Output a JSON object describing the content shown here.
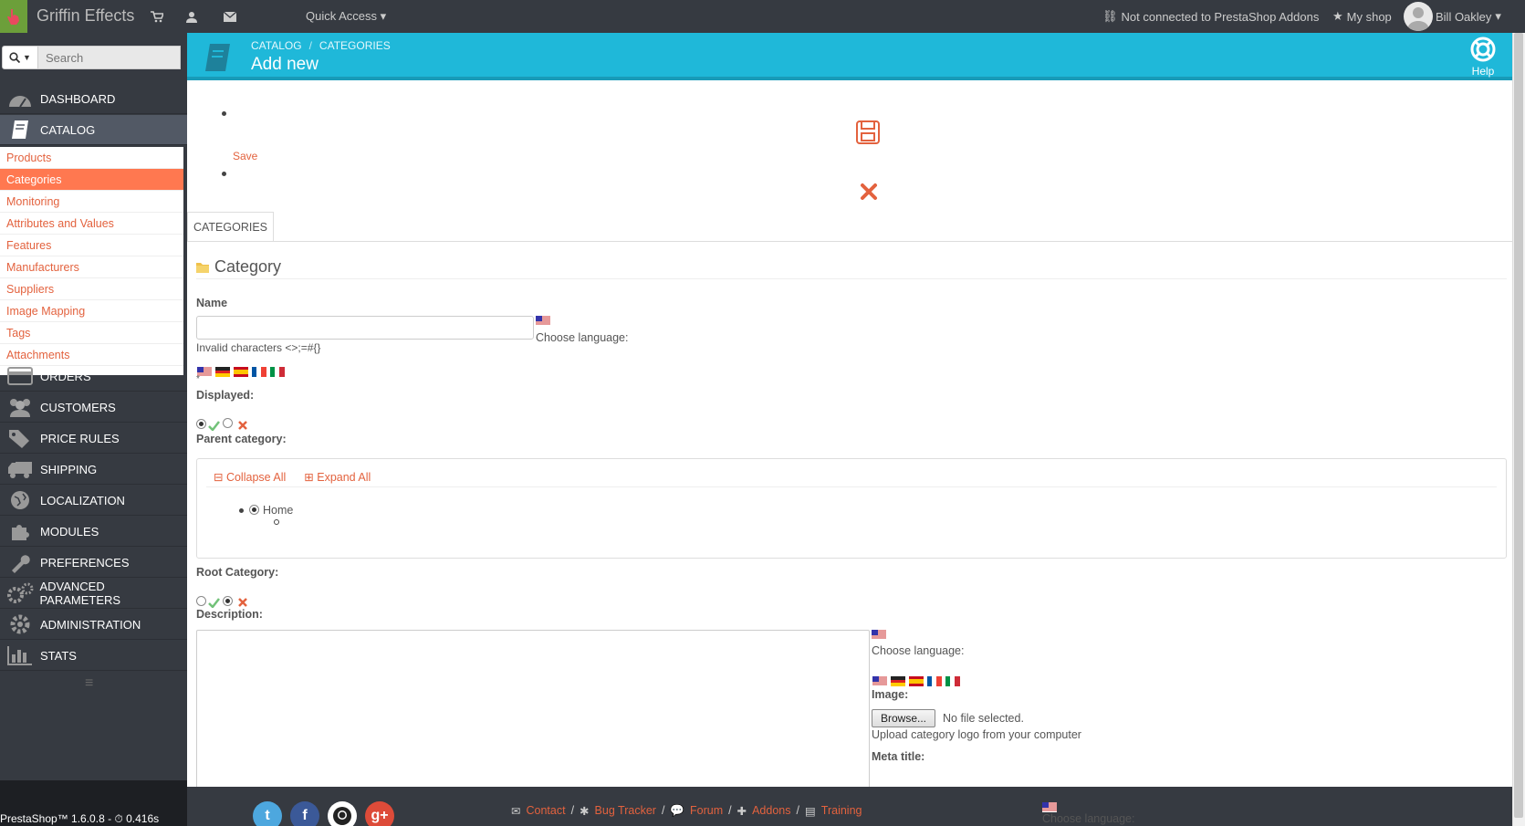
{
  "header": {
    "brand": "Griffin Effects",
    "quick_access": "Quick Access",
    "not_connected": "Not connected to PrestaShop Addons",
    "my_shop": "My shop",
    "user": "Bill Oakley"
  },
  "sidebar": {
    "search_placeholder": "Search",
    "menu": [
      {
        "label": "DASHBOARD",
        "icon": "dashboard-icon"
      },
      {
        "label": "CATALOG",
        "icon": "book-icon"
      },
      {
        "label": "ORDERS",
        "icon": "credit-card-icon"
      },
      {
        "label": "CUSTOMERS",
        "icon": "users-icon"
      },
      {
        "label": "PRICE RULES",
        "icon": "tags-icon"
      },
      {
        "label": "SHIPPING",
        "icon": "truck-icon"
      },
      {
        "label": "LOCALIZATION",
        "icon": "globe-icon"
      },
      {
        "label": "MODULES",
        "icon": "puzzle-icon"
      },
      {
        "label": "PREFERENCES",
        "icon": "wrench-icon"
      },
      {
        "label": "ADVANCED PARAMETERS",
        "icon": "cogs-icon"
      },
      {
        "label": "ADMINISTRATION",
        "icon": "gear-icon"
      },
      {
        "label": "STATS",
        "icon": "bar-chart-icon"
      }
    ],
    "catalog_submenu": [
      "Products",
      "Categories",
      "Monitoring",
      "Attributes and Values",
      "Features",
      "Manufacturers",
      "Suppliers",
      "Image Mapping",
      "Tags",
      "Attachments"
    ]
  },
  "pagehead": {
    "breadcrumb": [
      "CATALOG",
      "CATEGORIES"
    ],
    "title": "Add new",
    "help": "Help"
  },
  "toolbar": {
    "save": "Save"
  },
  "tabs": [
    "CATEGORIES"
  ],
  "form": {
    "panel_title": "Category",
    "name_label": "Name",
    "name_value": "",
    "choose_language": "Choose language:",
    "invalid_chars": "Invalid characters <>;=#{}",
    "required_mark": "*",
    "displayed_label": "Displayed:",
    "parent_label": "Parent category:",
    "collapse_all": "Collapse All",
    "expand_all": "Expand All",
    "tree_root": "Home",
    "root_category_label": "Root Category:",
    "description_label": "Description:",
    "image_label": "Image:",
    "browse": "Browse...",
    "no_file": "No file selected.",
    "upload_hint": "Upload category logo from your computer",
    "meta_title_label": "Meta title:",
    "choose_language_cut": "Choose language:"
  },
  "footer": {
    "version": "PrestaShop™ 1.6.0.8 - ",
    "time": "0.416s",
    "links": [
      "Contact",
      "Bug Tracker",
      "Forum",
      "Addons",
      "Training"
    ],
    "social": [
      "twitter-icon",
      "facebook-icon",
      "github-icon",
      "google-plus-icon"
    ]
  },
  "colors": {
    "accent": "#1fb8d9",
    "link": "#e3623e",
    "selected": "#ff7850",
    "dark": "#363a41"
  }
}
